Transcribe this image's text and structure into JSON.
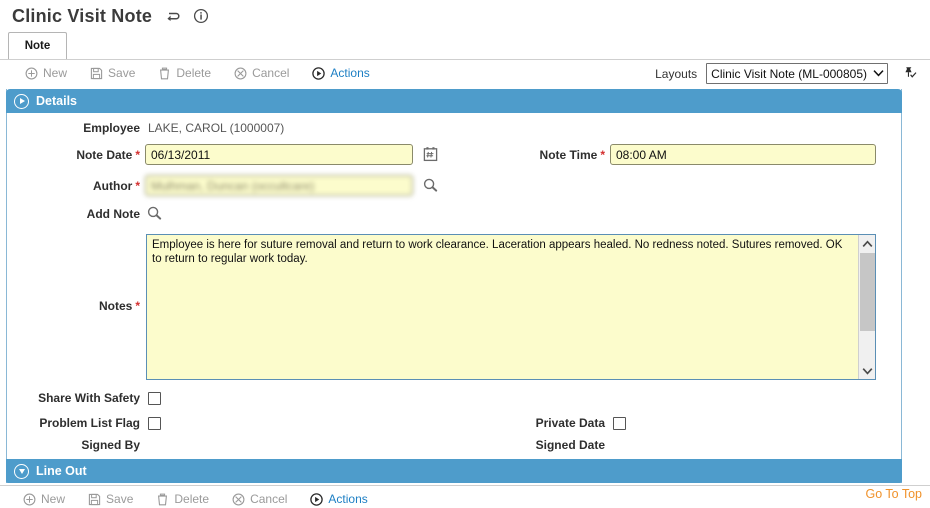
{
  "titlebar": {
    "title": "Clinic Visit Note",
    "back_icon": "back-arrow-icon",
    "info_icon": "info-icon"
  },
  "tabs": [
    {
      "label": "Note",
      "active": true
    }
  ],
  "toolbar": {
    "new_label": "New",
    "save_label": "Save",
    "delete_label": "Delete",
    "cancel_label": "Cancel",
    "actions_label": "Actions",
    "layouts_label": "Layouts",
    "layouts_value": "Clinic Visit Note (ML-000805)",
    "layouts_caret": "⌄",
    "pin_icon": "pin-check-icon"
  },
  "sections": {
    "details": {
      "title": "Details",
      "state": "collapsed-toggle-right"
    },
    "line_out": {
      "title": "Line Out",
      "state": "expanded-toggle-down"
    }
  },
  "form": {
    "employee_label": "Employee",
    "employee_value": "LAKE, CAROL (1000007)",
    "note_date_label": "Note Date",
    "note_date_value": "06/13/2011",
    "note_date_icon": "calendar-icon",
    "note_time_label": "Note Time",
    "note_time_value": "08:00 AM",
    "author_label": "Author",
    "author_value": "Mulhman, Duncan (occultcare)",
    "author_icon": "search-icon",
    "add_note_label": "Add Note",
    "add_note_icon": "search-icon",
    "notes_label": "Notes",
    "notes_value": "Employee is here for suture removal and return to work clearance. Laceration appears healed. No redness noted. Sutures removed. OK to return to regular work today.",
    "share_with_safety_label": "Share With Safety",
    "share_with_safety_checked": false,
    "problem_list_flag_label": "Problem List Flag",
    "problem_list_flag_checked": false,
    "private_data_label": "Private Data",
    "private_data_checked": false,
    "signed_by_label": "Signed By",
    "signed_by_value": "",
    "signed_date_label": "Signed Date",
    "signed_date_value": "",
    "required_marker": "*"
  },
  "footer": {
    "go_to_top_label": "Go To Top"
  },
  "colors": {
    "section_blue": "#4e9ccb",
    "field_yellow": "#fcfccc",
    "link_blue": "#1d7fc4",
    "accent_orange": "#f0922b",
    "required_red": "#d32f2f"
  }
}
